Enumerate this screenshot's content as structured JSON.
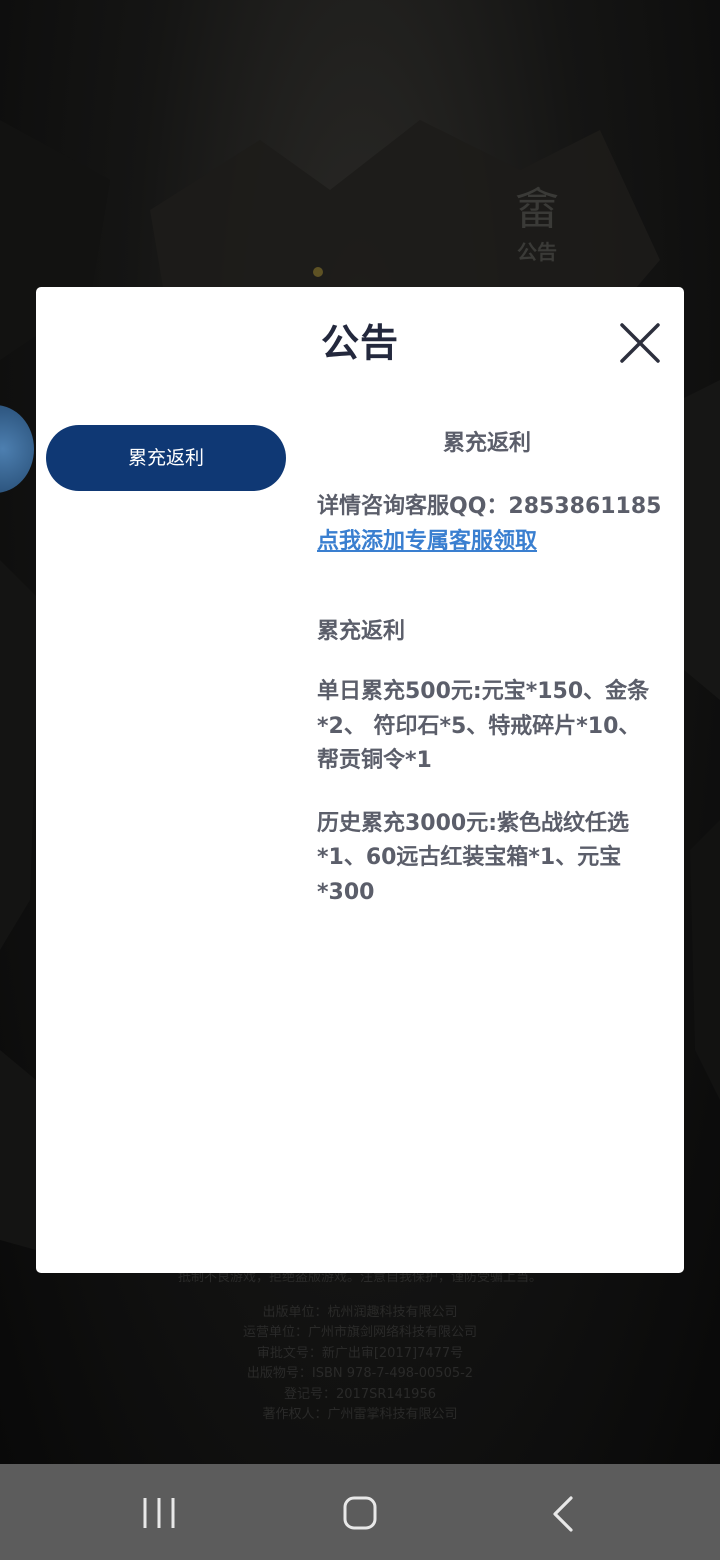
{
  "background": {
    "notice_icon_glyph": "畲",
    "notice_icon_label": "公告",
    "footer_lines": [
      "抵制不良游戏，拒绝盗版游戏。注意自我保护，谨防受骗上当。",
      "出版单位：杭州润趣科技有限公司",
      "运营单位：广州市旗剑网络科技有限公司",
      "审批文号：新广出审[2017]7477号",
      "出版物号：ISBN 978-7-498-00505-2",
      "登记号：2017SR141956",
      "著作权人：广州雷掌科技有限公司"
    ]
  },
  "dialog": {
    "title": "公告",
    "close_icon": "close-icon",
    "tabs": [
      {
        "label": "累充返利",
        "active": true
      }
    ],
    "content": {
      "title": "累充返利",
      "contact_text": "详情咨询客服QQ：2853861185",
      "contact_link": "点我添加专属客服领取",
      "section_heading": "累充返利",
      "paragraphs": [
        "单日累充500元:元宝*150、金条*2、 符印石*5、特戒碎片*10、帮贡铜令*1",
        "历史累充3000元:紫色战纹任选*1、60远古红装宝箱*1、元宝*300"
      ]
    }
  },
  "navbar": {
    "recents_icon": "recents-icon",
    "home_icon": "home-icon",
    "back_icon": "back-icon"
  },
  "colors": {
    "tab_active_bg": "#0f3874",
    "link": "#3a7fd0",
    "title": "#23283d",
    "body_text": "#5b5e6a",
    "navbar_bg": "#5c5c5c"
  }
}
